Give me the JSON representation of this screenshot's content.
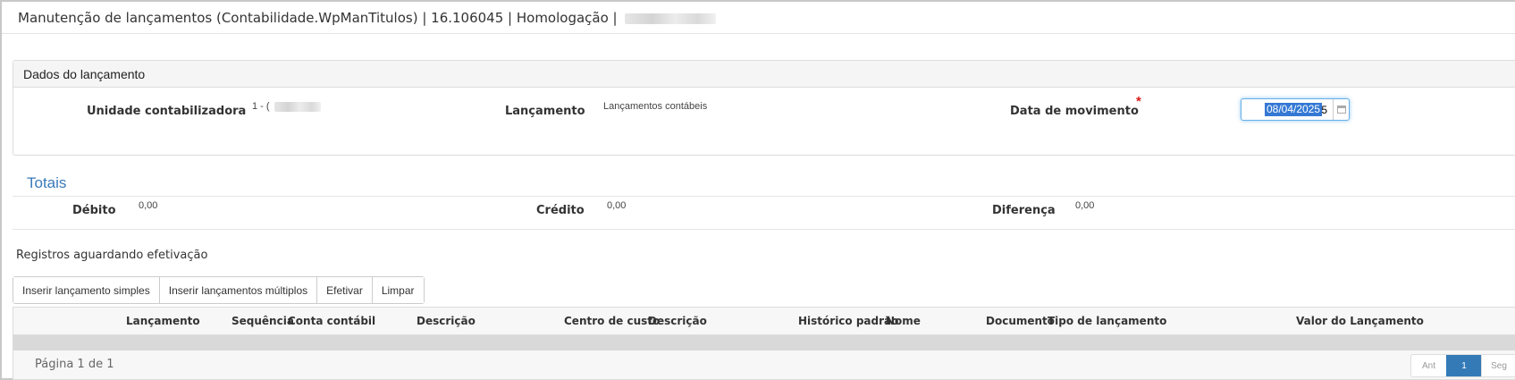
{
  "window": {
    "title": "Manutenção de lançamentos (Contabilidade.WpManTitulos) | 16.106045 | Homologação |"
  },
  "panel": {
    "header": "Dados do lançamento",
    "unidade_label": "Unidade contabilizadora",
    "unidade_value": "1 - (",
    "lancamento_label": "Lançamento",
    "lancamento_value": "Lançamentos contábeis",
    "data_label": "Data de movimento",
    "required_mark": "*",
    "data_value": "08/04/2025"
  },
  "totais": {
    "title": "Totais",
    "debito_label": "Débito",
    "debito_value": "0,00",
    "credito_label": "Crédito",
    "credito_value": "0,00",
    "diferenca_label": "Diferença",
    "diferenca_value": "0,00"
  },
  "registros": {
    "title": "Registros aguardando efetivação",
    "buttons": [
      "Inserir lançamento simples",
      "Inserir lançamentos múltiplos",
      "Efetivar",
      "Limpar"
    ]
  },
  "grid": {
    "columns": [
      "Lançamento",
      "Sequência",
      "Conta contábil",
      "Descrição",
      "Centro de custo",
      "Descrição",
      "Histórico padrão",
      "Nome",
      "Documento",
      "Tipo de lançamento",
      "Valor do Lançamento"
    ],
    "rows": [],
    "page_info": "Página 1 de 1",
    "pager": {
      "prev": "Ant",
      "current": "1",
      "next": "Seg"
    }
  },
  "colors": {
    "accent": "#337ab7",
    "section_title": "#3a79b8",
    "required": "#d9201e",
    "selection": "#3478d4"
  },
  "icons": [
    "calendar-icon"
  ]
}
